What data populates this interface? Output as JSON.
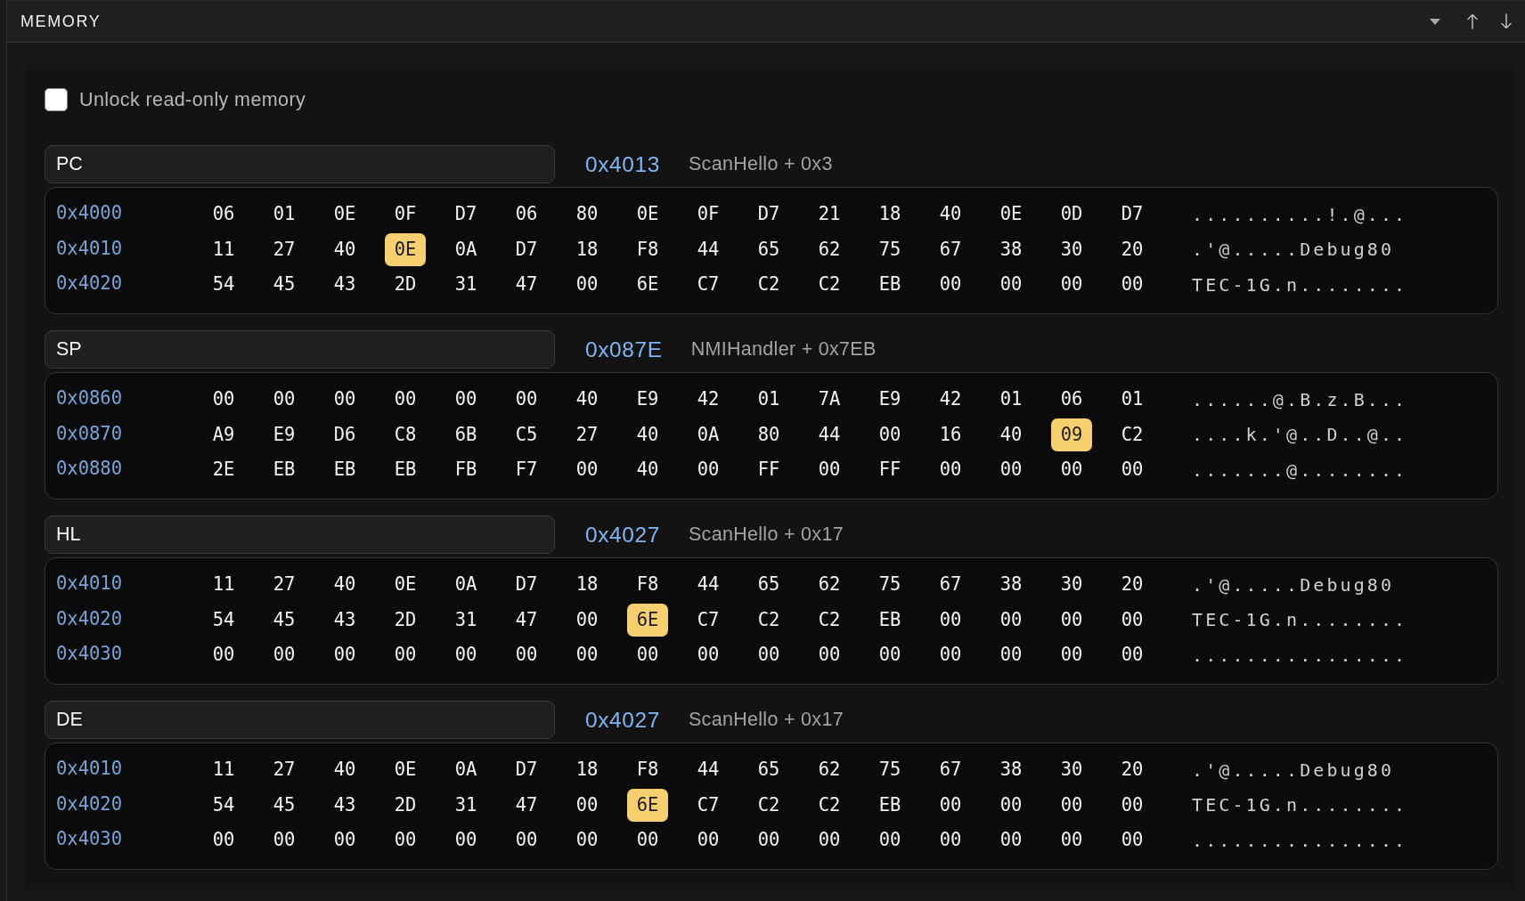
{
  "panel": {
    "title": "MEMORY"
  },
  "unlock": {
    "label": "Unlock read-only memory",
    "checked": false
  },
  "views": [
    {
      "register": "PC",
      "address": "0x4013",
      "symbol": "ScanHello + 0x3",
      "rows": [
        {
          "address": "0x4000",
          "bytes": [
            {
              "value": "06",
              "highlighted": false
            },
            {
              "value": "01",
              "highlighted": false
            },
            {
              "value": "0E",
              "highlighted": false
            },
            {
              "value": "0F",
              "highlighted": false
            },
            {
              "value": "D7",
              "highlighted": false
            },
            {
              "value": "06",
              "highlighted": false
            },
            {
              "value": "80",
              "highlighted": false
            },
            {
              "value": "0E",
              "highlighted": false
            },
            {
              "value": "0F",
              "highlighted": false
            },
            {
              "value": "D7",
              "highlighted": false
            },
            {
              "value": "21",
              "highlighted": false
            },
            {
              "value": "18",
              "highlighted": false
            },
            {
              "value": "40",
              "highlighted": false
            },
            {
              "value": "0E",
              "highlighted": false
            },
            {
              "value": "0D",
              "highlighted": false
            },
            {
              "value": "D7",
              "highlighted": false
            }
          ],
          "ascii": "..........!.@..."
        },
        {
          "address": "0x4010",
          "bytes": [
            {
              "value": "11",
              "highlighted": false
            },
            {
              "value": "27",
              "highlighted": false
            },
            {
              "value": "40",
              "highlighted": false
            },
            {
              "value": "0E",
              "highlighted": true
            },
            {
              "value": "0A",
              "highlighted": false
            },
            {
              "value": "D7",
              "highlighted": false
            },
            {
              "value": "18",
              "highlighted": false
            },
            {
              "value": "F8",
              "highlighted": false
            },
            {
              "value": "44",
              "highlighted": false
            },
            {
              "value": "65",
              "highlighted": false
            },
            {
              "value": "62",
              "highlighted": false
            },
            {
              "value": "75",
              "highlighted": false
            },
            {
              "value": "67",
              "highlighted": false
            },
            {
              "value": "38",
              "highlighted": false
            },
            {
              "value": "30",
              "highlighted": false
            },
            {
              "value": "20",
              "highlighted": false
            }
          ],
          "ascii": ".'@.....Debug80"
        },
        {
          "address": "0x4020",
          "bytes": [
            {
              "value": "54",
              "highlighted": false
            },
            {
              "value": "45",
              "highlighted": false
            },
            {
              "value": "43",
              "highlighted": false
            },
            {
              "value": "2D",
              "highlighted": false
            },
            {
              "value": "31",
              "highlighted": false
            },
            {
              "value": "47",
              "highlighted": false
            },
            {
              "value": "00",
              "highlighted": false
            },
            {
              "value": "6E",
              "highlighted": false
            },
            {
              "value": "C7",
              "highlighted": false
            },
            {
              "value": "C2",
              "highlighted": false
            },
            {
              "value": "C2",
              "highlighted": false
            },
            {
              "value": "EB",
              "highlighted": false
            },
            {
              "value": "00",
              "highlighted": false
            },
            {
              "value": "00",
              "highlighted": false
            },
            {
              "value": "00",
              "highlighted": false
            },
            {
              "value": "00",
              "highlighted": false
            }
          ],
          "ascii": "TEC-1G.n........"
        }
      ]
    },
    {
      "register": "SP",
      "address": "0x087E",
      "symbol": "NMIHandler + 0x7EB",
      "rows": [
        {
          "address": "0x0860",
          "bytes": [
            {
              "value": "00",
              "highlighted": false
            },
            {
              "value": "00",
              "highlighted": false
            },
            {
              "value": "00",
              "highlighted": false
            },
            {
              "value": "00",
              "highlighted": false
            },
            {
              "value": "00",
              "highlighted": false
            },
            {
              "value": "00",
              "highlighted": false
            },
            {
              "value": "40",
              "highlighted": false
            },
            {
              "value": "E9",
              "highlighted": false
            },
            {
              "value": "42",
              "highlighted": false
            },
            {
              "value": "01",
              "highlighted": false
            },
            {
              "value": "7A",
              "highlighted": false
            },
            {
              "value": "E9",
              "highlighted": false
            },
            {
              "value": "42",
              "highlighted": false
            },
            {
              "value": "01",
              "highlighted": false
            },
            {
              "value": "06",
              "highlighted": false
            },
            {
              "value": "01",
              "highlighted": false
            }
          ],
          "ascii": "......@.B.z.B..."
        },
        {
          "address": "0x0870",
          "bytes": [
            {
              "value": "A9",
              "highlighted": false
            },
            {
              "value": "E9",
              "highlighted": false
            },
            {
              "value": "D6",
              "highlighted": false
            },
            {
              "value": "C8",
              "highlighted": false
            },
            {
              "value": "6B",
              "highlighted": false
            },
            {
              "value": "C5",
              "highlighted": false
            },
            {
              "value": "27",
              "highlighted": false
            },
            {
              "value": "40",
              "highlighted": false
            },
            {
              "value": "0A",
              "highlighted": false
            },
            {
              "value": "80",
              "highlighted": false
            },
            {
              "value": "44",
              "highlighted": false
            },
            {
              "value": "00",
              "highlighted": false
            },
            {
              "value": "16",
              "highlighted": false
            },
            {
              "value": "40",
              "highlighted": false
            },
            {
              "value": "09",
              "highlighted": true
            },
            {
              "value": "C2",
              "highlighted": false
            }
          ],
          "ascii": "....k.'@..D..@.."
        },
        {
          "address": "0x0880",
          "bytes": [
            {
              "value": "2E",
              "highlighted": false
            },
            {
              "value": "EB",
              "highlighted": false
            },
            {
              "value": "EB",
              "highlighted": false
            },
            {
              "value": "EB",
              "highlighted": false
            },
            {
              "value": "FB",
              "highlighted": false
            },
            {
              "value": "F7",
              "highlighted": false
            },
            {
              "value": "00",
              "highlighted": false
            },
            {
              "value": "40",
              "highlighted": false
            },
            {
              "value": "00",
              "highlighted": false
            },
            {
              "value": "FF",
              "highlighted": false
            },
            {
              "value": "00",
              "highlighted": false
            },
            {
              "value": "FF",
              "highlighted": false
            },
            {
              "value": "00",
              "highlighted": false
            },
            {
              "value": "00",
              "highlighted": false
            },
            {
              "value": "00",
              "highlighted": false
            },
            {
              "value": "00",
              "highlighted": false
            }
          ],
          "ascii": ".......@........"
        }
      ]
    },
    {
      "register": "HL",
      "address": "0x4027",
      "symbol": "ScanHello + 0x17",
      "rows": [
        {
          "address": "0x4010",
          "bytes": [
            {
              "value": "11",
              "highlighted": false
            },
            {
              "value": "27",
              "highlighted": false
            },
            {
              "value": "40",
              "highlighted": false
            },
            {
              "value": "0E",
              "highlighted": false
            },
            {
              "value": "0A",
              "highlighted": false
            },
            {
              "value": "D7",
              "highlighted": false
            },
            {
              "value": "18",
              "highlighted": false
            },
            {
              "value": "F8",
              "highlighted": false
            },
            {
              "value": "44",
              "highlighted": false
            },
            {
              "value": "65",
              "highlighted": false
            },
            {
              "value": "62",
              "highlighted": false
            },
            {
              "value": "75",
              "highlighted": false
            },
            {
              "value": "67",
              "highlighted": false
            },
            {
              "value": "38",
              "highlighted": false
            },
            {
              "value": "30",
              "highlighted": false
            },
            {
              "value": "20",
              "highlighted": false
            }
          ],
          "ascii": ".'@.....Debug80"
        },
        {
          "address": "0x4020",
          "bytes": [
            {
              "value": "54",
              "highlighted": false
            },
            {
              "value": "45",
              "highlighted": false
            },
            {
              "value": "43",
              "highlighted": false
            },
            {
              "value": "2D",
              "highlighted": false
            },
            {
              "value": "31",
              "highlighted": false
            },
            {
              "value": "47",
              "highlighted": false
            },
            {
              "value": "00",
              "highlighted": false
            },
            {
              "value": "6E",
              "highlighted": true
            },
            {
              "value": "C7",
              "highlighted": false
            },
            {
              "value": "C2",
              "highlighted": false
            },
            {
              "value": "C2",
              "highlighted": false
            },
            {
              "value": "EB",
              "highlighted": false
            },
            {
              "value": "00",
              "highlighted": false
            },
            {
              "value": "00",
              "highlighted": false
            },
            {
              "value": "00",
              "highlighted": false
            },
            {
              "value": "00",
              "highlighted": false
            }
          ],
          "ascii": "TEC-1G.n........"
        },
        {
          "address": "0x4030",
          "bytes": [
            {
              "value": "00",
              "highlighted": false
            },
            {
              "value": "00",
              "highlighted": false
            },
            {
              "value": "00",
              "highlighted": false
            },
            {
              "value": "00",
              "highlighted": false
            },
            {
              "value": "00",
              "highlighted": false
            },
            {
              "value": "00",
              "highlighted": false
            },
            {
              "value": "00",
              "highlighted": false
            },
            {
              "value": "00",
              "highlighted": false
            },
            {
              "value": "00",
              "highlighted": false
            },
            {
              "value": "00",
              "highlighted": false
            },
            {
              "value": "00",
              "highlighted": false
            },
            {
              "value": "00",
              "highlighted": false
            },
            {
              "value": "00",
              "highlighted": false
            },
            {
              "value": "00",
              "highlighted": false
            },
            {
              "value": "00",
              "highlighted": false
            },
            {
              "value": "00",
              "highlighted": false
            }
          ],
          "ascii": "................"
        }
      ]
    },
    {
      "register": "DE",
      "address": "0x4027",
      "symbol": "ScanHello + 0x17",
      "rows": [
        {
          "address": "0x4010",
          "bytes": [
            {
              "value": "11",
              "highlighted": false
            },
            {
              "value": "27",
              "highlighted": false
            },
            {
              "value": "40",
              "highlighted": false
            },
            {
              "value": "0E",
              "highlighted": false
            },
            {
              "value": "0A",
              "highlighted": false
            },
            {
              "value": "D7",
              "highlighted": false
            },
            {
              "value": "18",
              "highlighted": false
            },
            {
              "value": "F8",
              "highlighted": false
            },
            {
              "value": "44",
              "highlighted": false
            },
            {
              "value": "65",
              "highlighted": false
            },
            {
              "value": "62",
              "highlighted": false
            },
            {
              "value": "75",
              "highlighted": false
            },
            {
              "value": "67",
              "highlighted": false
            },
            {
              "value": "38",
              "highlighted": false
            },
            {
              "value": "30",
              "highlighted": false
            },
            {
              "value": "20",
              "highlighted": false
            }
          ],
          "ascii": ".'@.....Debug80"
        },
        {
          "address": "0x4020",
          "bytes": [
            {
              "value": "54",
              "highlighted": false
            },
            {
              "value": "45",
              "highlighted": false
            },
            {
              "value": "43",
              "highlighted": false
            },
            {
              "value": "2D",
              "highlighted": false
            },
            {
              "value": "31",
              "highlighted": false
            },
            {
              "value": "47",
              "highlighted": false
            },
            {
              "value": "00",
              "highlighted": false
            },
            {
              "value": "6E",
              "highlighted": true
            },
            {
              "value": "C7",
              "highlighted": false
            },
            {
              "value": "C2",
              "highlighted": false
            },
            {
              "value": "C2",
              "highlighted": false
            },
            {
              "value": "EB",
              "highlighted": false
            },
            {
              "value": "00",
              "highlighted": false
            },
            {
              "value": "00",
              "highlighted": false
            },
            {
              "value": "00",
              "highlighted": false
            },
            {
              "value": "00",
              "highlighted": false
            }
          ],
          "ascii": "TEC-1G.n........"
        },
        {
          "address": "0x4030",
          "bytes": [
            {
              "value": "00",
              "highlighted": false
            },
            {
              "value": "00",
              "highlighted": false
            },
            {
              "value": "00",
              "highlighted": false
            },
            {
              "value": "00",
              "highlighted": false
            },
            {
              "value": "00",
              "highlighted": false
            },
            {
              "value": "00",
              "highlighted": false
            },
            {
              "value": "00",
              "highlighted": false
            },
            {
              "value": "00",
              "highlighted": false
            },
            {
              "value": "00",
              "highlighted": false
            },
            {
              "value": "00",
              "highlighted": false
            },
            {
              "value": "00",
              "highlighted": false
            },
            {
              "value": "00",
              "highlighted": false
            },
            {
              "value": "00",
              "highlighted": false
            },
            {
              "value": "00",
              "highlighted": false
            },
            {
              "value": "00",
              "highlighted": false
            },
            {
              "value": "00",
              "highlighted": false
            }
          ],
          "ascii": "................"
        }
      ]
    }
  ]
}
